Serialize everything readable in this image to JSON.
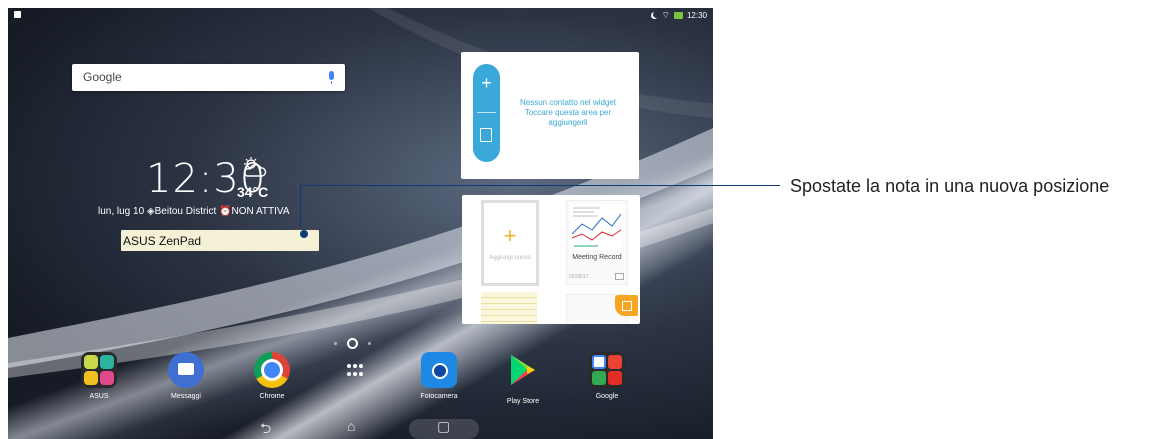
{
  "statusbar": {
    "time": "12:30"
  },
  "search": {
    "logo": "Google"
  },
  "clock": {
    "time": "12:30",
    "temperature": "34°C",
    "date_line": "lun, lug 10 ◈Beitou District ⏰NON ATTIVA"
  },
  "note": {
    "text": "ASUS ZenPad"
  },
  "contact_widget": {
    "plus": "+",
    "message": "Nessun contatto nel widget Toccare questa area per aggiungerli"
  },
  "notes_widget": {
    "add_label": "Aggiungi nuovo",
    "plus": "+",
    "meeting_title": "Meeting Record",
    "meeting_date": "02/06/17"
  },
  "dock": {
    "apps": [
      {
        "label": "ASUS",
        "icon": "asus-folder-icon"
      },
      {
        "label": "Messaggi",
        "icon": "messages-icon"
      },
      {
        "label": "Chrome",
        "icon": "chrome-icon"
      },
      {
        "label": "",
        "icon": "app-drawer-icon"
      },
      {
        "label": "Fotocamera",
        "icon": "camera-icon"
      },
      {
        "label": "Play Store",
        "icon": "play-store-icon"
      },
      {
        "label": "Google",
        "icon": "google-folder-icon"
      }
    ]
  },
  "navbar": {
    "back": "⮌",
    "home": "⌂",
    "recent": "▢"
  },
  "callout": {
    "text": "Spostate la nota in una nuova posizione"
  },
  "colors": {
    "accent_blue": "#3aa8d8",
    "callout_line": "#0b3c78",
    "notes_orange": "#f6a623"
  }
}
